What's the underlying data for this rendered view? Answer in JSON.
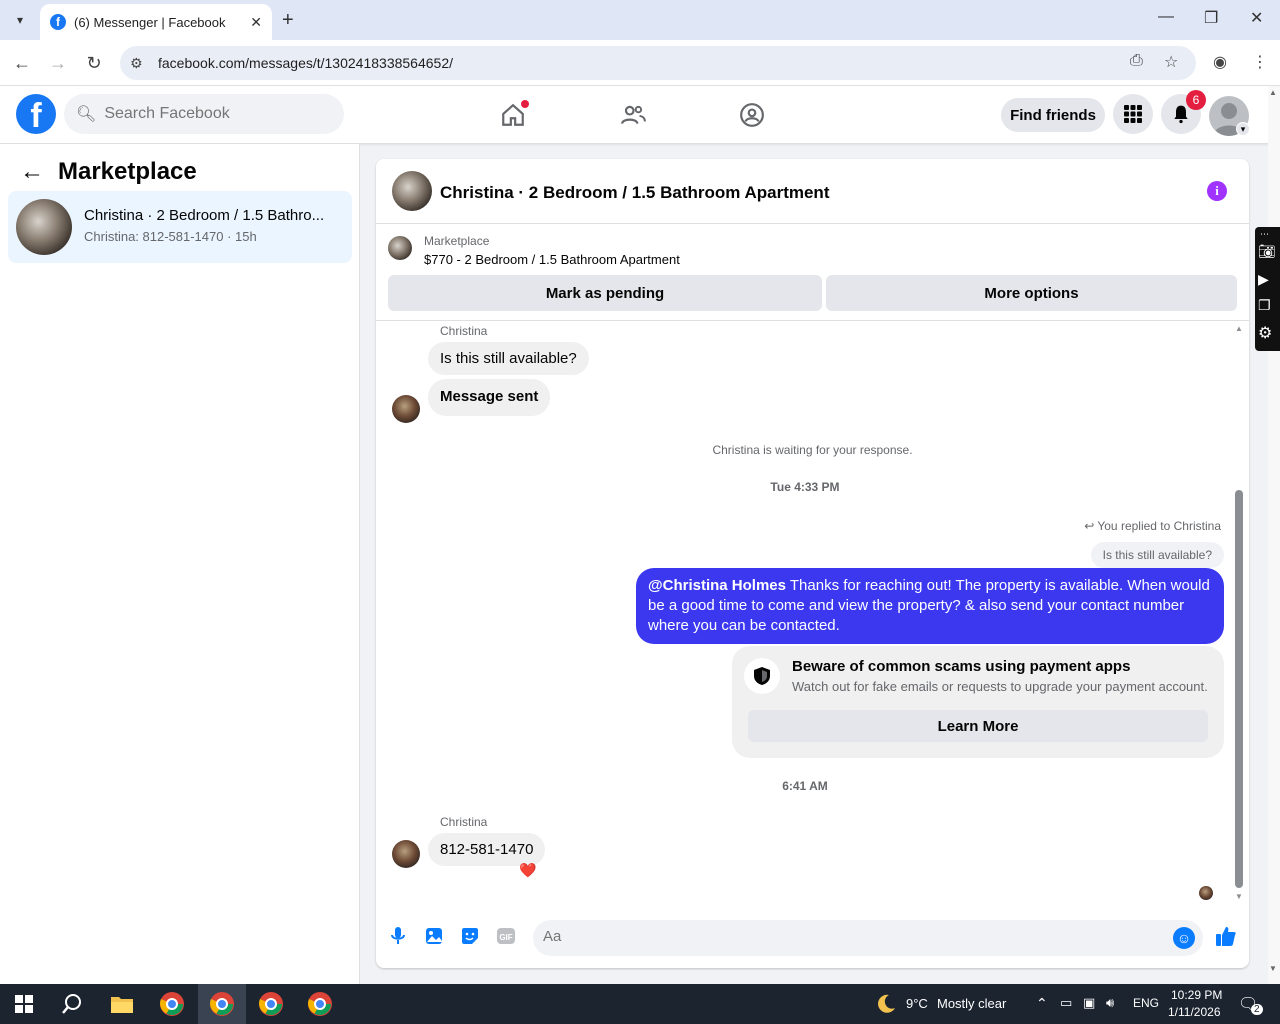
{
  "browser": {
    "tab_title": "(6) Messenger | Facebook",
    "url": "facebook.com/messages/t/1302418338564652/"
  },
  "header": {
    "search_placeholder": "Search Facebook",
    "find_friends": "Find friends",
    "notification_count": "6"
  },
  "sidebar": {
    "title": "Marketplace",
    "conversations": [
      {
        "name": "Christina · 2 Bedroom / 1.5 Bathro...",
        "preview": "Christina: 812-581-1470 · 15h"
      }
    ]
  },
  "chat": {
    "title": "Christina · 2 Bedroom / 1.5 Bathroom Apartment",
    "listing": {
      "source": "Marketplace",
      "title": "$770 - 2 Bedroom / 1.5 Bathroom Apartment",
      "btn_pending": "Mark as pending",
      "btn_more": "More options"
    },
    "messages": {
      "sender1": "Christina",
      "msg1": "Is this still available?",
      "msg2": "Message sent",
      "waiting": "Christina is waiting for your response.",
      "time1": "Tue 4:33 PM",
      "replied_to": "You replied to Christina",
      "quoted": "Is this still available?",
      "reply_mention": "@Christina Holmes",
      "reply_text": " Thanks for reaching out! The property is available. When would be a good time to come and view the property? & also send your contact number where you can be contacted.",
      "scam_title": "Beware of common scams using payment apps",
      "scam_sub": "Watch out for fake emails or requests to upgrade your payment account.",
      "scam_btn": "Learn More",
      "time2": "6:41 AM",
      "sender2": "Christina",
      "msg3": "812-581-1470",
      "reaction": "❤️"
    },
    "composer_placeholder": "Aa"
  },
  "taskbar": {
    "weather_temp": "9°C",
    "weather_desc": "Mostly clear",
    "lang": "ENG",
    "time": "10:29 PM",
    "date": "1/11/2026",
    "notif": "2"
  },
  "colors": {
    "fb_blue": "#1877f2",
    "my_bubble": "#3b38f0",
    "badge_red": "#e41e3f"
  }
}
